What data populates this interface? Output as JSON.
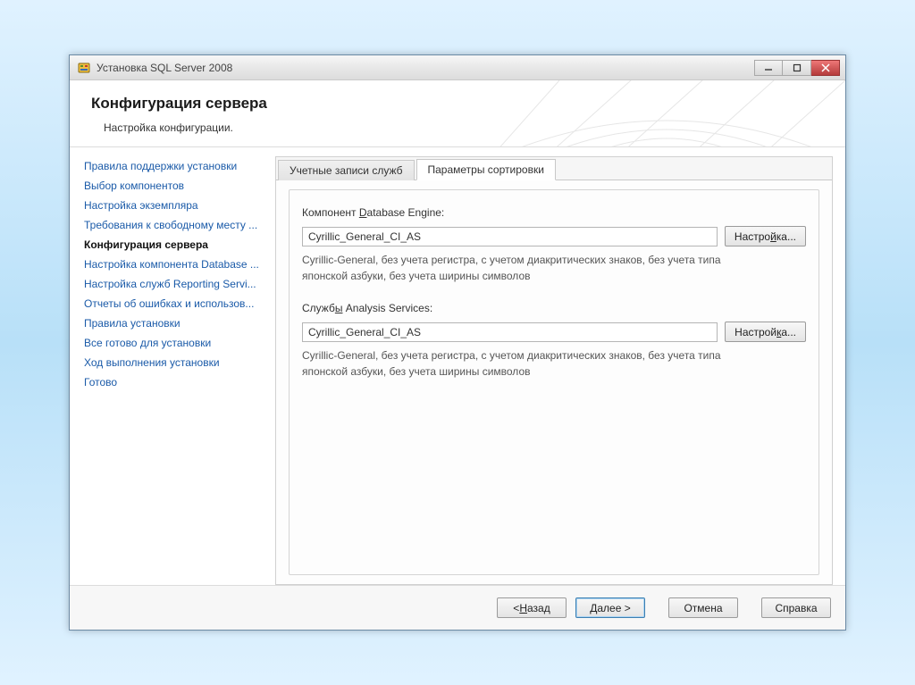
{
  "window": {
    "title": "Установка SQL Server 2008"
  },
  "header": {
    "title": "Конфигурация сервера",
    "subtitle": "Настройка конфигурации."
  },
  "sidebar": {
    "items": [
      "Правила поддержки установки",
      "Выбор компонентов",
      "Настройка экземпляра",
      "Требования к свободному месту ...",
      "Конфигурация сервера",
      "Настройка компонента Database ...",
      "Настройка служб Reporting Servi...",
      "Отчеты об ошибках и использов...",
      "Правила установки",
      "Все готово для установки",
      "Ход выполнения установки",
      "Готово"
    ],
    "active_index": 4
  },
  "tabs": {
    "items": [
      "Учетные записи служб",
      "Параметры сортировки"
    ],
    "active_index": 1
  },
  "content": {
    "db_engine": {
      "label_prefix": "Компонент ",
      "label_underline": "D",
      "label_suffix": "atabase Engine:",
      "value": "Cyrillic_General_CI_AS",
      "customize_before": "Настро",
      "customize_underline": "й",
      "customize_after": "ка...",
      "description": "Cyrillic-General, без учета регистра, с учетом диакритических знаков, без учета типа японской азбуки, без учета ширины символов"
    },
    "analysis": {
      "label_prefix": "Служб",
      "label_underline": "ы",
      "label_suffix": " Analysis Services:",
      "value": "Cyrillic_General_CI_AS",
      "customize_before": "Настрой",
      "customize_underline": "к",
      "customize_after": "а...",
      "description": "Cyrillic-General, без учета регистра, с учетом диакритических знаков, без учета типа японской азбуки, без учета ширины символов"
    }
  },
  "footer": {
    "back_before": "< ",
    "back_underline": "Н",
    "back_after": "азад",
    "next_before": "",
    "next_underline": "Д",
    "next_after": "алее >",
    "cancel": "Отмена",
    "help": "Справка"
  }
}
